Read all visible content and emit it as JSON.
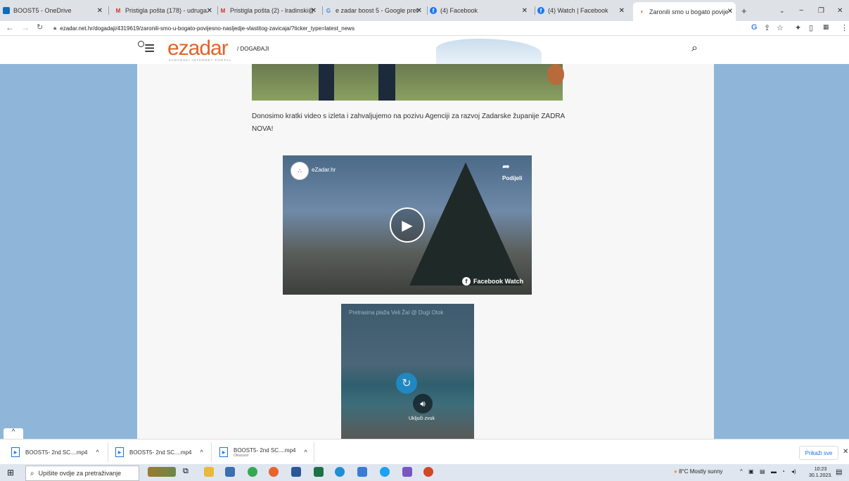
{
  "tabs": [
    {
      "title": "BOOST5 - OneDrive",
      "icon": "onedrive-icon",
      "color": "#0f6cbd"
    },
    {
      "title": "Pristigla pošta (178) - udruga...",
      "icon": "gmail-icon",
      "color": "#d93025"
    },
    {
      "title": "Pristigla pošta (2) - lradinski@g...",
      "icon": "gmail-icon",
      "color": "#d93025"
    },
    {
      "title": "e zadar boost 5 - Google pretra...",
      "icon": "google-icon",
      "color": "#4285f4"
    },
    {
      "title": "(4) Facebook",
      "icon": "facebook-icon",
      "color": "#1877f2"
    },
    {
      "title": "(4) Watch | Facebook",
      "icon": "facebook-icon",
      "color": "#1877f2"
    },
    {
      "title": "Zaronili smo u bogato povijesno...",
      "icon": "ezadar-icon",
      "color": "#e0632a"
    }
  ],
  "address": {
    "url": "ezadar.net.hr/dogadaji/4319619/zaronili-smo-u-bogato-povijesno-nasljedje-vlastitog-zavicaja/?ticker_type=latest_news"
  },
  "site": {
    "logo_text": "ezadar",
    "logo_sub": "ZADARSKI INTERNET PORTAL",
    "section": "/ DOGAĐAJI"
  },
  "article": {
    "paragraph": "Donosimo kratki video s izleta i zahvaljujemo na pozivu Agenciji za razvoj Zadarske županije ZADRA NOVA!"
  },
  "fb_video": {
    "page_name": "eZadar.hr",
    "share_label": "Podijeli",
    "watermark": "Facebook Watch"
  },
  "video2": {
    "title": "Pretrasina plaža Veli Žal @ Dugi Otok",
    "sound_label": "Uključi zvuk"
  },
  "downloads": [
    {
      "name": "BOOST5- 2nd SC....mp4",
      "status": ""
    },
    {
      "name": "BOOST5- 2nd SC....mp4",
      "status": ""
    },
    {
      "name": "BOOST5- 2nd SC....mp4",
      "status": "Otkazano"
    }
  ],
  "downloads_bar": {
    "show_all": "Prikaži sve"
  },
  "taskbar": {
    "search_placeholder": "Upišite ovdje za pretraživanje",
    "weather": "8°C  Mostly sunny",
    "time": "10:23",
    "date": "30.1.2023."
  }
}
